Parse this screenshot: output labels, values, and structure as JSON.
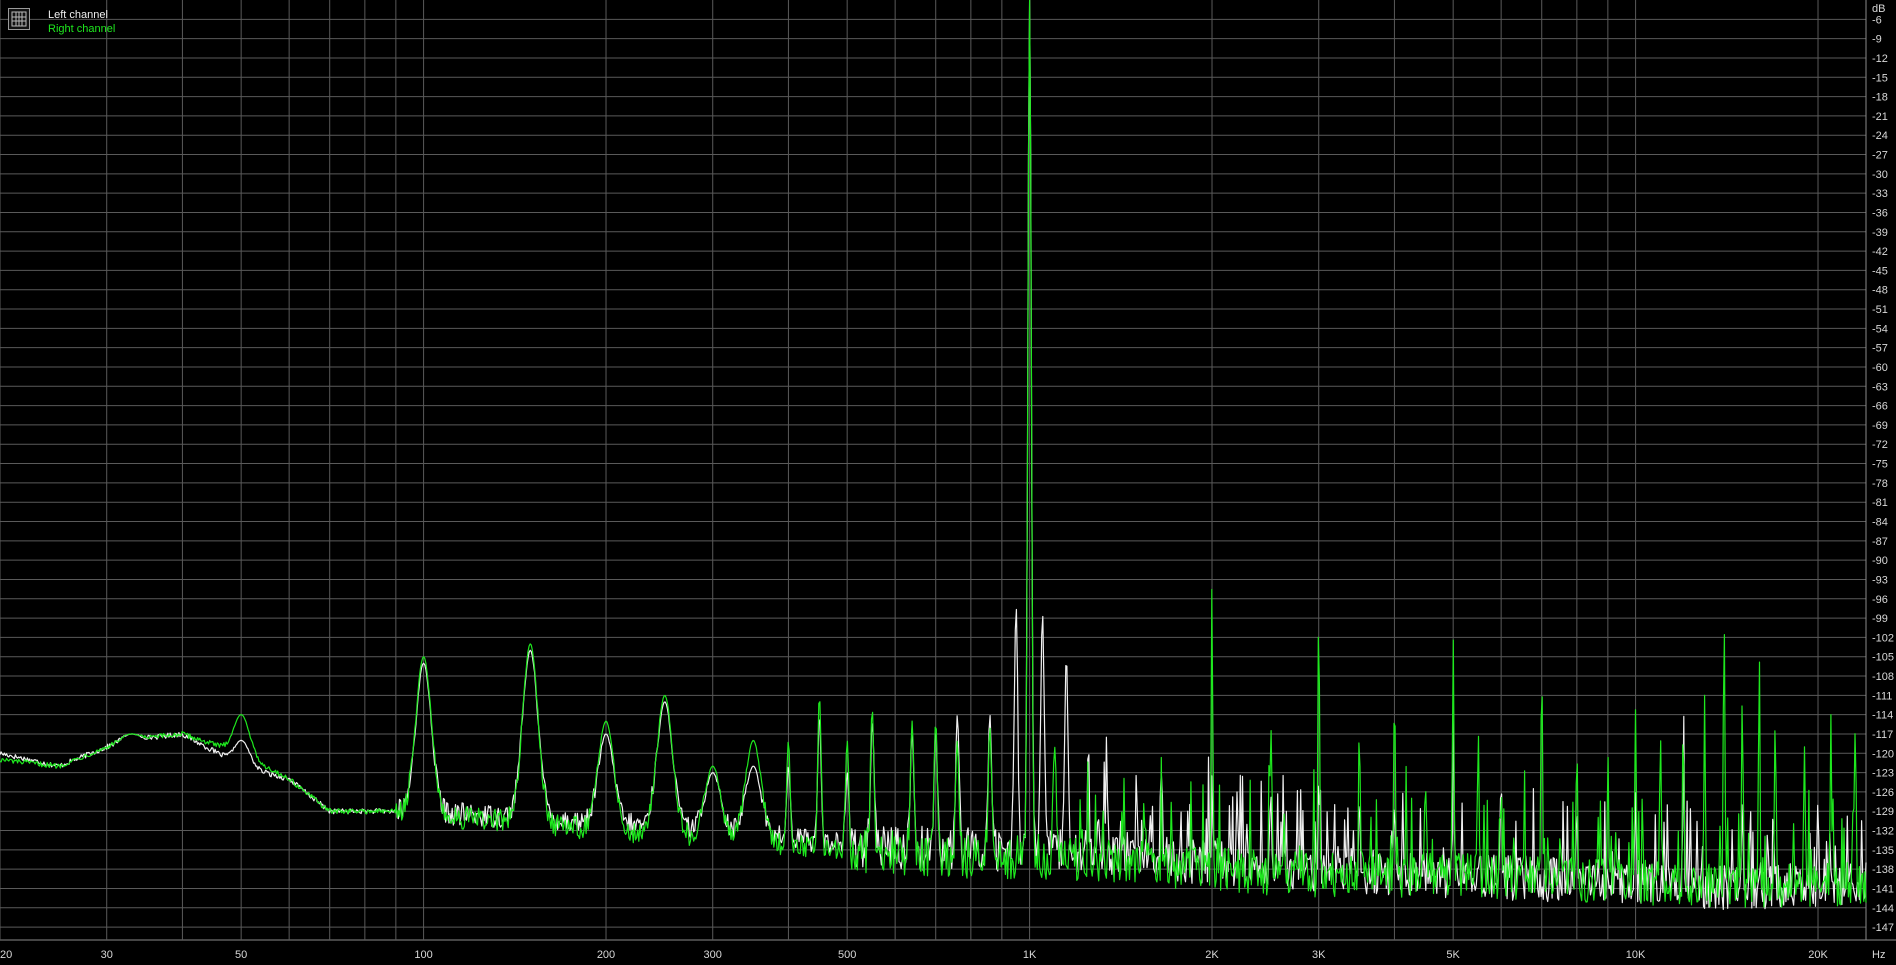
{
  "colors": {
    "background": "#000000",
    "grid": "#5a5a5a",
    "axis_text": "#d8d8d8",
    "left_channel": "#f0f0f0",
    "right_channel": "#1ee81e"
  },
  "legend": {
    "icon": "grid-icon",
    "left": "Left channel",
    "right": "Right channel"
  },
  "chart_data": {
    "type": "line",
    "x_scale": "log",
    "x_unit": "Hz",
    "y_unit": "dB",
    "xlim": [
      20,
      24000
    ],
    "ylim": [
      -149,
      -3
    ],
    "grid": true,
    "legend_position": "top-left",
    "x_ticks": [
      {
        "v": 20,
        "l": "20"
      },
      {
        "v": 30,
        "l": "30"
      },
      {
        "v": 50,
        "l": "50"
      },
      {
        "v": 100,
        "l": "100"
      },
      {
        "v": 200,
        "l": "200"
      },
      {
        "v": 300,
        "l": "300"
      },
      {
        "v": 500,
        "l": "500"
      },
      {
        "v": 1000,
        "l": "1K"
      },
      {
        "v": 2000,
        "l": "2K"
      },
      {
        "v": 3000,
        "l": "3K"
      },
      {
        "v": 5000,
        "l": "5K"
      },
      {
        "v": 10000,
        "l": "10K"
      },
      {
        "v": 20000,
        "l": "20K"
      }
    ],
    "y_ticks": [
      -6,
      -9,
      -12,
      -15,
      -18,
      -21,
      -24,
      -27,
      -30,
      -33,
      -36,
      -39,
      -42,
      -45,
      -48,
      -51,
      -54,
      -57,
      -60,
      -63,
      -66,
      -69,
      -72,
      -75,
      -78,
      -81,
      -84,
      -87,
      -90,
      -93,
      -96,
      -99,
      -102,
      -105,
      -108,
      -111,
      -114,
      -117,
      -120,
      -123,
      -126,
      -129,
      -132,
      -135,
      -138,
      -141,
      -144,
      -147
    ],
    "series": [
      {
        "name": "Left channel",
        "base": [
          [
            20,
            -120
          ],
          [
            25,
            -122
          ],
          [
            32,
            -118
          ],
          [
            40,
            -117
          ],
          [
            50,
            -122
          ],
          [
            60,
            -124
          ],
          [
            70,
            -129
          ],
          [
            80,
            -129
          ],
          [
            90,
            -129
          ],
          [
            150,
            -130
          ],
          [
            300,
            -132
          ],
          [
            500,
            -134
          ],
          [
            700,
            -135
          ],
          [
            1000,
            -135
          ],
          [
            1500,
            -136
          ],
          [
            2000,
            -137
          ],
          [
            3000,
            -138
          ],
          [
            5000,
            -139
          ],
          [
            10000,
            -140
          ],
          [
            15000,
            -141
          ],
          [
            24000,
            -140
          ]
        ],
        "peaks": [
          [
            33,
            -117
          ],
          [
            50,
            -118
          ],
          [
            100,
            -106
          ],
          [
            150,
            -104
          ],
          [
            200,
            -117
          ],
          [
            250,
            -112
          ],
          [
            300,
            -123
          ],
          [
            350,
            -122
          ],
          [
            400,
            -122
          ],
          [
            450,
            -114
          ],
          [
            500,
            -123
          ],
          [
            550,
            -115
          ],
          [
            640,
            -116
          ],
          [
            700,
            -116
          ],
          [
            760,
            -114
          ],
          [
            860,
            -114
          ],
          [
            950,
            -97
          ],
          [
            1000,
            -3
          ],
          [
            1050,
            -98
          ],
          [
            1150,
            -105
          ],
          [
            1250,
            -116
          ],
          [
            1340,
            -117
          ],
          [
            1500,
            -123
          ],
          [
            1650,
            -123
          ],
          [
            2000,
            -123
          ],
          [
            2200,
            -126
          ],
          [
            2500,
            -126
          ],
          [
            3000,
            -123
          ],
          [
            3500,
            -127
          ],
          [
            4000,
            -127
          ],
          [
            5000,
            -123
          ],
          [
            6000,
            -126
          ],
          [
            8000,
            -128
          ],
          [
            10000,
            -126
          ],
          [
            12000,
            -126
          ],
          [
            15000,
            -127
          ],
          [
            20000,
            -127
          ]
        ]
      },
      {
        "name": "Right channel",
        "base": [
          [
            20,
            -121
          ],
          [
            25,
            -122
          ],
          [
            32,
            -118
          ],
          [
            40,
            -117
          ],
          [
            50,
            -120
          ],
          [
            60,
            -124
          ],
          [
            70,
            -129
          ],
          [
            80,
            -129
          ],
          [
            90,
            -129
          ],
          [
            150,
            -131
          ],
          [
            300,
            -133
          ],
          [
            500,
            -135
          ],
          [
            700,
            -136
          ],
          [
            1000,
            -136
          ],
          [
            1500,
            -137
          ],
          [
            2000,
            -138
          ],
          [
            3000,
            -139
          ],
          [
            5000,
            -139
          ],
          [
            10000,
            -140
          ],
          [
            15000,
            -141
          ],
          [
            24000,
            -140
          ]
        ],
        "peaks": [
          [
            33,
            -117
          ],
          [
            50,
            -114
          ],
          [
            100,
            -105
          ],
          [
            150,
            -103
          ],
          [
            200,
            -115
          ],
          [
            250,
            -111
          ],
          [
            300,
            -122
          ],
          [
            350,
            -118
          ],
          [
            400,
            -118
          ],
          [
            450,
            -111
          ],
          [
            500,
            -118
          ],
          [
            550,
            -113
          ],
          [
            640,
            -115
          ],
          [
            700,
            -115
          ],
          [
            760,
            -118
          ],
          [
            860,
            -116
          ],
          [
            1000,
            -3
          ],
          [
            1100,
            -119
          ],
          [
            2000,
            -93
          ],
          [
            2500,
            -114
          ],
          [
            3000,
            -95
          ],
          [
            3500,
            -115
          ],
          [
            4000,
            -112
          ],
          [
            4500,
            -124
          ],
          [
            5000,
            -102
          ],
          [
            5500,
            -116
          ],
          [
            6000,
            -125
          ],
          [
            7000,
            -106
          ],
          [
            8000,
            -118
          ],
          [
            9000,
            -120
          ],
          [
            10000,
            -113
          ],
          [
            11000,
            -118
          ],
          [
            12000,
            -121
          ],
          [
            13000,
            -111
          ],
          [
            14000,
            -105
          ],
          [
            15000,
            -110
          ],
          [
            16000,
            -104
          ],
          [
            17000,
            -114
          ],
          [
            19000,
            -119
          ],
          [
            21000,
            -114
          ],
          [
            23000,
            -116
          ]
        ]
      }
    ]
  }
}
